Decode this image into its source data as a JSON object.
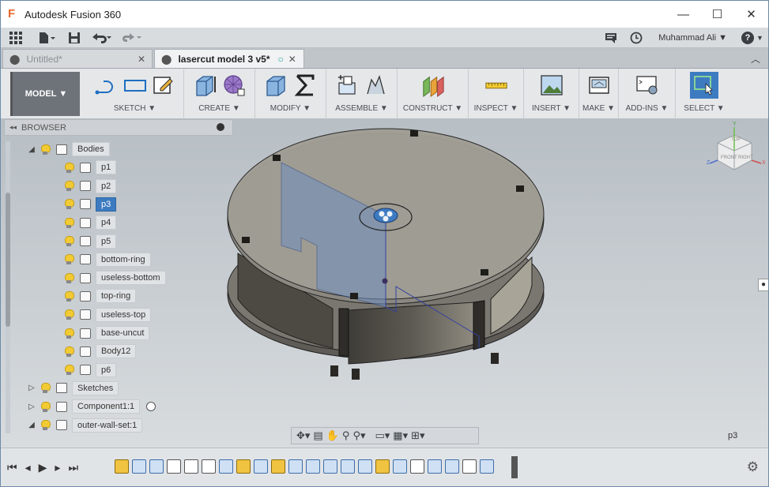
{
  "window": {
    "title": "Autodesk Fusion 360",
    "logo": "F",
    "minimize": "—",
    "maximize": "☐",
    "close": "✕"
  },
  "quick_access": {
    "user": "Muhammad Ali ▼",
    "help": "?"
  },
  "tabs": [
    {
      "label": "Untitled*",
      "active": false
    },
    {
      "label": "lasercut model 3 v5*",
      "active": true
    }
  ],
  "toolbar": {
    "workspace": "MODEL ▼",
    "groups": [
      "SKETCH ▼",
      "CREATE ▼",
      "MODIFY ▼",
      "ASSEMBLE ▼",
      "CONSTRUCT ▼",
      "INSPECT ▼",
      "INSERT ▼",
      "MAKE ▼",
      "ADD-INS ▼",
      "SELECT ▼"
    ]
  },
  "browser": {
    "title": "BROWSER",
    "items": [
      {
        "label": "Bodies",
        "level": 1,
        "type": "folder",
        "caret": "◢"
      },
      {
        "label": "p1",
        "level": 2,
        "type": "body"
      },
      {
        "label": "p2",
        "level": 2,
        "type": "body"
      },
      {
        "label": "p3",
        "level": 2,
        "type": "body",
        "selected": true
      },
      {
        "label": "p4",
        "level": 2,
        "type": "body"
      },
      {
        "label": "p5",
        "level": 2,
        "type": "body"
      },
      {
        "label": "bottom-ring",
        "level": 2,
        "type": "body"
      },
      {
        "label": "useless-bottom",
        "level": 2,
        "type": "body"
      },
      {
        "label": "top-ring",
        "level": 2,
        "type": "body"
      },
      {
        "label": "useless-top",
        "level": 2,
        "type": "body"
      },
      {
        "label": "base-uncut",
        "level": 2,
        "type": "body"
      },
      {
        "label": "Body12",
        "level": 2,
        "type": "body"
      },
      {
        "label": "p6",
        "level": 2,
        "type": "body"
      },
      {
        "label": "Sketches",
        "level": 1,
        "type": "folder",
        "caret": "▷"
      },
      {
        "label": "Component1:1",
        "level": 1,
        "type": "component",
        "caret": "▷",
        "radio": true
      },
      {
        "label": "outer-wall-set:1",
        "level": 1,
        "type": "component",
        "caret": "◢"
      }
    ]
  },
  "viewcube": {
    "top": "TOP",
    "front": "FRONT",
    "right": "RIGHT",
    "x": "X",
    "y": "Y",
    "z": "Z"
  },
  "status": {
    "selection": "p3"
  },
  "colors": {
    "accent": "#3d7bc1",
    "bulb": "#f2cb34"
  }
}
